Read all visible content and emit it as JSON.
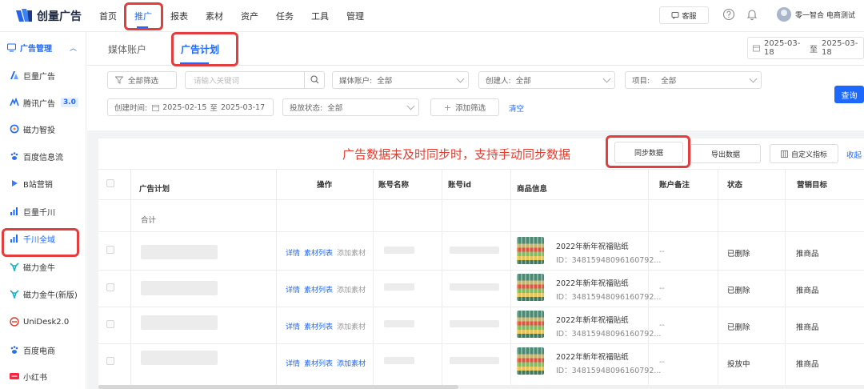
{
  "brand": {
    "name": "创量广告"
  },
  "nav": {
    "items": [
      "首页",
      "推广",
      "报表",
      "素材",
      "资产",
      "任务",
      "工具",
      "管理"
    ],
    "active": "推广"
  },
  "header_right": {
    "service": "客服",
    "user": "零一智合 电商测试"
  },
  "sidebar": {
    "group": "广告管理",
    "items": [
      {
        "label": "巨量广告",
        "icon": "juliang-icon"
      },
      {
        "label": "腾讯广告",
        "badge": "3.0",
        "icon": "tencent-icon"
      },
      {
        "label": "磁力智投",
        "icon": "cili-icon"
      },
      {
        "label": "百度信息流",
        "icon": "baidu-feed-icon"
      },
      {
        "label": "B站营销",
        "icon": "bilibili-icon"
      },
      {
        "label": "巨量千川",
        "icon": "qianchuan-icon"
      },
      {
        "label": "千川全域",
        "icon": "qianchuan-all-icon"
      },
      {
        "label": "磁力金牛",
        "icon": "jinniu-icon"
      },
      {
        "label": "磁力金牛(新版)",
        "icon": "jinniu-new-icon"
      },
      {
        "label": "UniDesk2.0",
        "icon": "unidesk-icon"
      },
      {
        "label": "百度电商",
        "icon": "baidu-shop-icon"
      },
      {
        "label": "小红书",
        "icon": "xiaohongshu-icon"
      }
    ]
  },
  "tabs": [
    {
      "label": "媒体账户"
    },
    {
      "label": "广告计划",
      "active": true
    }
  ],
  "date_range_top": {
    "start": "2025-03-18",
    "sep": "至",
    "end": "2025-03-18"
  },
  "filters": {
    "all_filter": "全部筛选",
    "keyword_placeholder": "请输入关键词",
    "media_account": {
      "label": "媒体账户:",
      "value": "全部"
    },
    "creator": {
      "label": "创建人:",
      "value": "全部"
    },
    "project": {
      "label": "项目:",
      "value": "全部"
    },
    "create_time": {
      "label": "创建时间:",
      "start": "2025-02-15",
      "sep": "至",
      "end": "2025-03-17"
    },
    "delivery_status": {
      "label": "投放状态:",
      "value": "全部"
    },
    "add_filter": "添加筛选",
    "clear": "清空",
    "query": "查询"
  },
  "annotation": "广告数据未及时同步时，支持手动同步数据",
  "actions": {
    "sync": "同步数据",
    "export": "导出数据",
    "custom_metrics": "自定义指标",
    "collapse": "收起"
  },
  "table": {
    "headers": [
      "广告计划",
      "操作",
      "账号名称",
      "账号id",
      "商品信息",
      "账户备注",
      "状态",
      "营销目标"
    ],
    "total_label": "合计",
    "row_ops": [
      "详情",
      "素材列表",
      "添加素材"
    ],
    "rows": [
      {
        "product_name": "2022年新年祝福贴纸",
        "product_id": "ID：34815948096160792...",
        "remark": "--",
        "status": "已删除",
        "goal": "推商品"
      },
      {
        "product_name": "2022年新年祝福贴纸",
        "product_id": "ID：34815948096160792...",
        "remark": "--",
        "status": "已删除",
        "goal": "推商品"
      },
      {
        "product_name": "2022年新年祝福贴纸",
        "product_id": "ID：34815948096160792...",
        "remark": "--",
        "status": "已删除",
        "goal": "推商品"
      },
      {
        "product_name": "2022年新年祝福贴纸",
        "product_id": "ID：34815948096160792...",
        "remark": "--",
        "status": "投放中",
        "goal": "推商品"
      }
    ]
  },
  "colors": {
    "accent": "#1d68ff",
    "highlight": "#e33d3d",
    "annotation": "#e63b2e"
  }
}
